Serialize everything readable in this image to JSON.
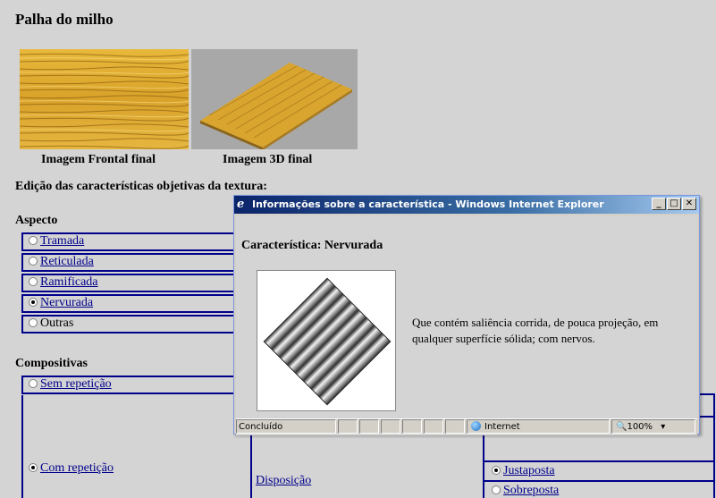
{
  "page": {
    "title": "Palha do milho",
    "caption_frontal": "Imagem Frontal final",
    "caption_3d": "Imagem 3D final",
    "edit_title": "Edição das características objetivas da textura:"
  },
  "aspecto": {
    "label": "Aspecto",
    "options": [
      {
        "label": "Tramada",
        "checked": false,
        "link": true
      },
      {
        "label": "Reticulada",
        "checked": false,
        "link": true
      },
      {
        "label": "Ramificada",
        "checked": false,
        "link": true
      },
      {
        "label": "Nervurada",
        "checked": true,
        "link": true
      },
      {
        "label": "Outras",
        "checked": false,
        "link": false
      }
    ]
  },
  "compositivas": {
    "label": "Compositivas",
    "sem_repeticao": "Sem repetição",
    "com_repeticao": "Com repetição",
    "disposicao": "Disposição",
    "justaposta": "Justaposta",
    "sobreposta": "Sobreposta"
  },
  "popup": {
    "window_title": "Informações sobre a característica - Windows Internet Explorer",
    "heading": "Característica: Nervurada",
    "description": "Que contém saliência corrida, de pouca projeção, em qualquer superfície sólida; com nervos.",
    "status_text": "Concluído",
    "zone": "Internet",
    "zoom": "100%",
    "zoom_icon": "zoom-icon",
    "globe_icon": "globe-icon",
    "ie_icon": "ie-logo-icon"
  },
  "colors": {
    "link": "#00008b",
    "border": "#00008b",
    "background": "#d4d4d4",
    "titlebar": "#0a246a"
  }
}
